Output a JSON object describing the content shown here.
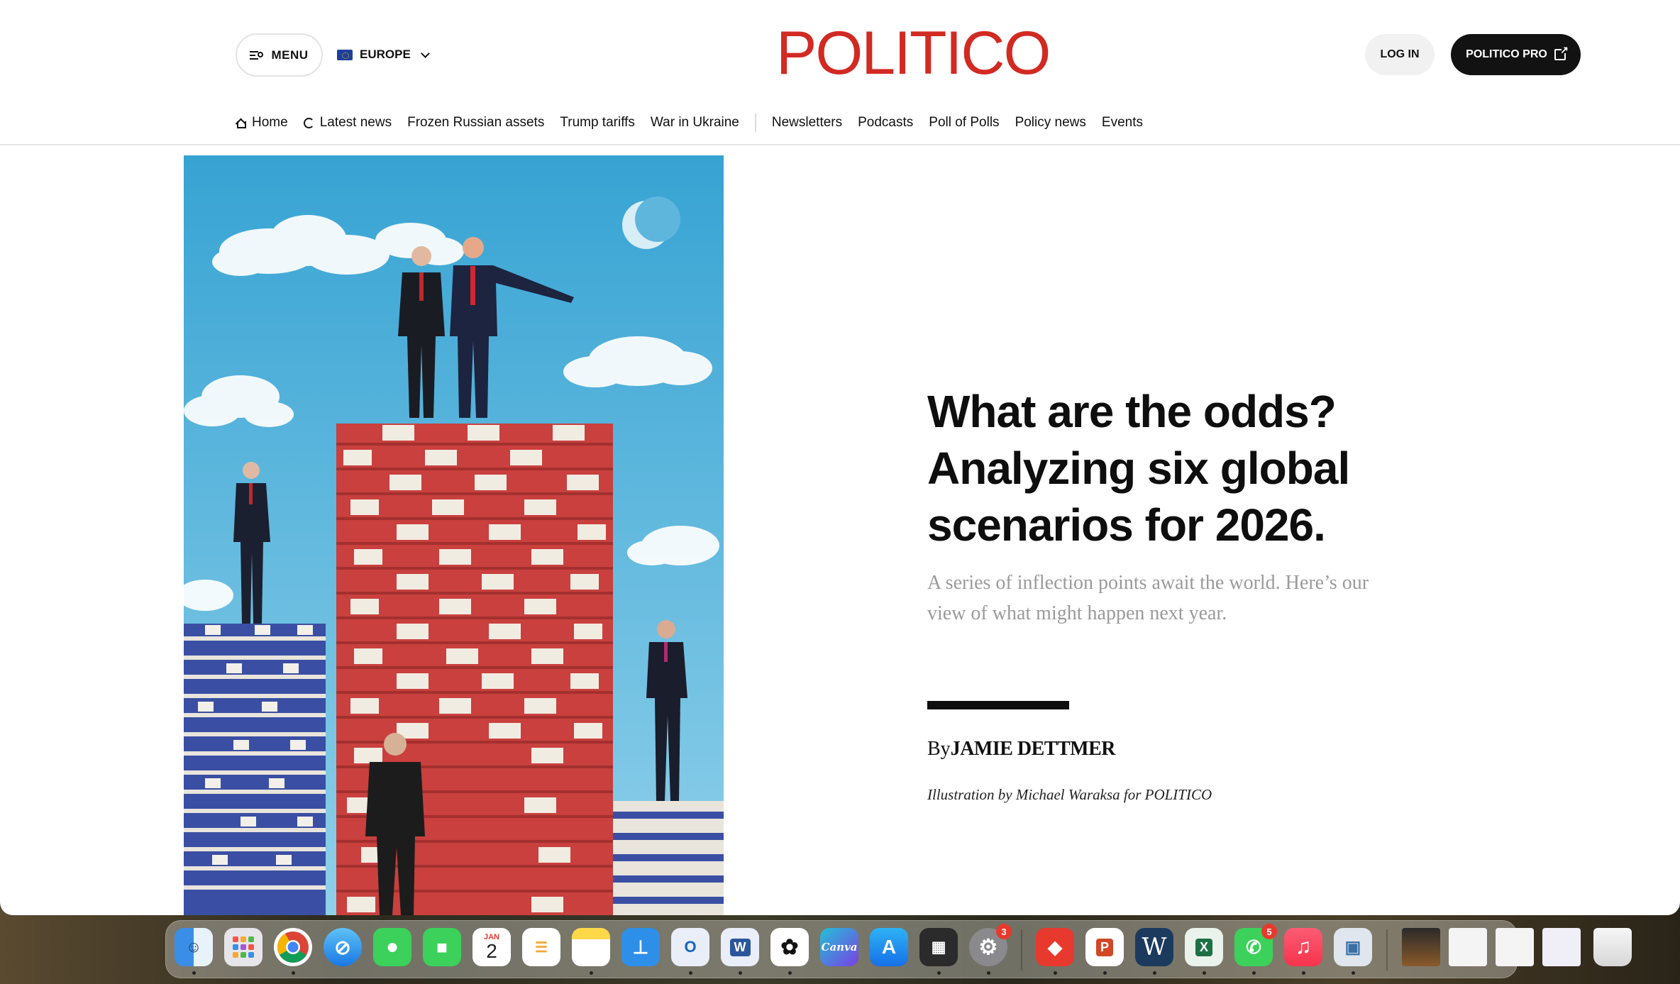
{
  "header": {
    "menu_label": "MENU",
    "region_label": "EUROPE",
    "logo_text": "POLITICO",
    "login_label": "LOG IN",
    "pro_label": "POLITICO PRO"
  },
  "nav": {
    "items": [
      {
        "label": "Home"
      },
      {
        "label": "Latest news"
      },
      {
        "label": "Frozen Russian assets"
      },
      {
        "label": "Trump tariffs"
      },
      {
        "label": "War in Ukraine"
      },
      {
        "label": "Newsletters"
      },
      {
        "label": "Podcasts"
      },
      {
        "label": "Poll of Polls"
      },
      {
        "label": "Policy news"
      },
      {
        "label": "Events"
      }
    ]
  },
  "article": {
    "headline": "What are the odds? Analyzing six global scenarios for 2026.",
    "subhead": "A series of inflection points await the world. Here’s our view of what might happen next year.",
    "byline_prefix": "By",
    "author": "JAMIE DETTMER",
    "illustration_credit": "Illustration by Michael Waraksa for POLITICO"
  },
  "dock": {
    "calendar_month": "JAN",
    "calendar_day": "2",
    "settings_badge": "3",
    "whatsapp_badge": "5",
    "canva_label": "Canva",
    "word_label": "W"
  },
  "colors": {
    "brand_red": "#d12a23",
    "chip_red": "#c9403e",
    "chip_blue": "#3a4fa3"
  }
}
